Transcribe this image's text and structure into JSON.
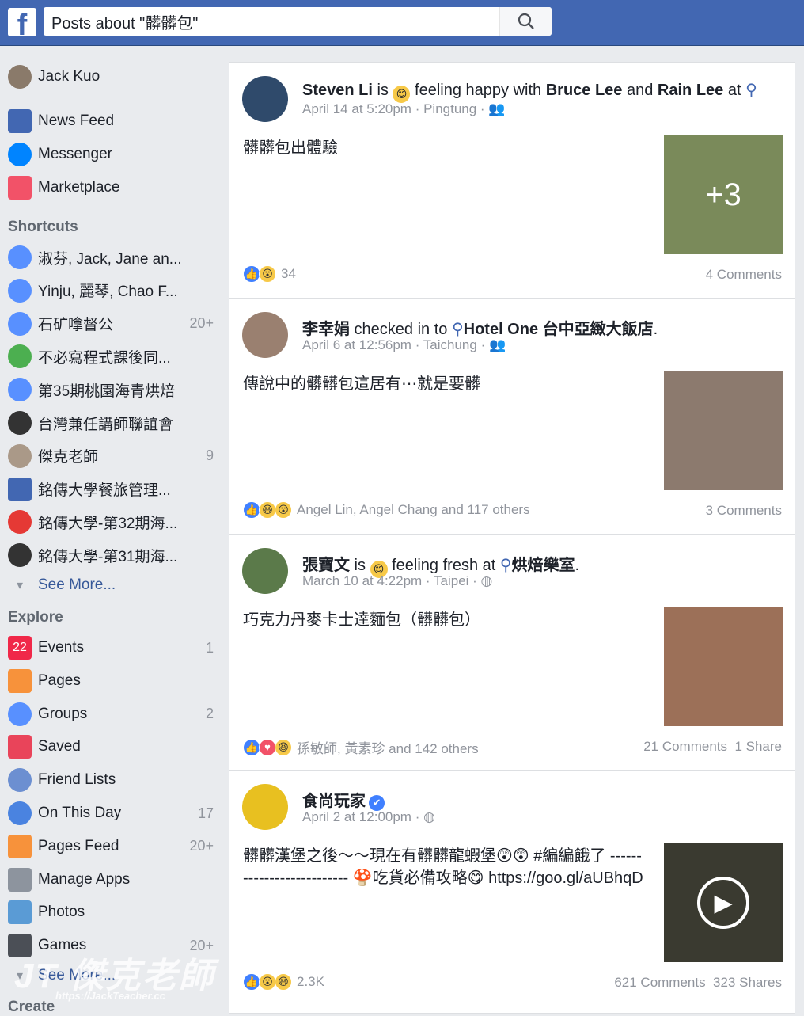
{
  "topbar": {
    "logo": "f",
    "search_value": "Posts about \"髒髒包\""
  },
  "sidebar": {
    "user": {
      "label": "Jack Kuo"
    },
    "main": [
      {
        "label": "News Feed",
        "icon": "news-feed-icon",
        "color": "#4267b2"
      },
      {
        "label": "Messenger",
        "icon": "messenger-icon",
        "color": "#0084ff"
      },
      {
        "label": "Marketplace",
        "icon": "marketplace-icon",
        "color": "#f25268"
      }
    ],
    "shortcuts_title": "Shortcuts",
    "shortcuts": [
      {
        "label": "淑芬, Jack, Jane an...",
        "count": "",
        "icon": "group-icon",
        "color": "#5890ff"
      },
      {
        "label": "Yinju, 麗琴, Chao F...",
        "count": "",
        "icon": "group-icon",
        "color": "#5890ff"
      },
      {
        "label": "石矿嗱督公",
        "count": "20+",
        "icon": "group-icon",
        "color": "#5890ff"
      },
      {
        "label": "不必寫程式課後同...",
        "count": "",
        "icon": "globe-icon",
        "color": "#4caf50"
      },
      {
        "label": "第35期桃園海青烘焙",
        "count": "",
        "icon": "group-icon",
        "color": "#5890ff"
      },
      {
        "label": "台灣兼任講師聯誼會",
        "count": "",
        "icon": "graduation-cap-icon",
        "color": "#333"
      },
      {
        "label": "傑克老師",
        "count": "9",
        "icon": "page-avatar-icon",
        "color": "#a98"
      },
      {
        "label": "銘傳大學餐旅管理...",
        "count": "",
        "icon": "page-icon",
        "color": "#4267b2"
      },
      {
        "label": "銘傳大學-第32期海...",
        "count": "",
        "icon": "apple-icon",
        "color": "#e53935"
      },
      {
        "label": "銘傳大學-第31期海...",
        "count": "",
        "icon": "graduation-cap-icon",
        "color": "#333"
      }
    ],
    "see_more_1": "See More...",
    "explore_title": "Explore",
    "explore": [
      {
        "label": "Events",
        "count": "1",
        "icon": "calendar-icon",
        "color": "#f02849",
        "glyph": "22"
      },
      {
        "label": "Pages",
        "count": "",
        "icon": "flag-icon",
        "color": "#f7923b"
      },
      {
        "label": "Groups",
        "count": "2",
        "icon": "groups-icon",
        "color": "#5890ff"
      },
      {
        "label": "Saved",
        "count": "",
        "icon": "bookmark-icon",
        "color": "#e9445a"
      },
      {
        "label": "Friend Lists",
        "count": "",
        "icon": "friend-list-icon",
        "color": "#6c8fd1"
      },
      {
        "label": "On This Day",
        "count": "17",
        "icon": "clock-icon",
        "color": "#4a83e0"
      },
      {
        "label": "Pages Feed",
        "count": "20+",
        "icon": "pages-feed-icon",
        "color": "#f7923b"
      },
      {
        "label": "Manage Apps",
        "count": "",
        "icon": "wrench-icon",
        "color": "#8d949e"
      },
      {
        "label": "Photos",
        "count": "",
        "icon": "photos-icon",
        "color": "#5a9bd5"
      },
      {
        "label": "Games",
        "count": "20+",
        "icon": "games-icon",
        "color": "#4b4f56"
      }
    ],
    "see_more_2": "See More...",
    "create_title": "Create"
  },
  "posts": [
    {
      "author": "Steven Li",
      "header_rest": [
        " is ",
        "😊",
        " feeling happy with ",
        "Bruce Lee",
        " and ",
        "Rain Lee",
        " at ",
        "📍"
      ],
      "time": "April 14 at 5:20pm",
      "place": "Pingtung",
      "privacy": "friends-icon",
      "body": "髒髒包出體驗",
      "thumb_overlay": "+3",
      "reactions": [
        "like",
        "wow"
      ],
      "reaction_text": "34",
      "stats": "4 Comments",
      "avatar_color": "#2f4a6b",
      "thumb_color": "#7a8a5a"
    },
    {
      "author": "李幸娟",
      "header_rest": [
        " checked in to ",
        "📍",
        "Hotel One 台中亞緻大飯店",
        "."
      ],
      "time": "April 6 at 12:56pm",
      "place": "Taichung",
      "privacy": "friends-icon",
      "body": "傳說中的髒髒包這居有⋯就是要髒",
      "thumb_overlay": "",
      "reactions": [
        "like",
        "haha",
        "wow"
      ],
      "reaction_text": "Angel Lin, Angel Chang and 117 others",
      "stats": "3 Comments",
      "avatar_color": "#9a8070",
      "thumb_color": "#8c7a6e"
    },
    {
      "author": "張寶文",
      "header_rest": [
        " is ",
        "😊",
        " feeling fresh at ",
        "📍",
        "烘焙樂室",
        "."
      ],
      "time": "March 10 at 4:22pm",
      "place": "Taipei",
      "privacy": "globe-icon",
      "body": "巧克力丹麥卡士達麵包（髒髒包）",
      "thumb_overlay": "",
      "reactions": [
        "like",
        "love",
        "haha"
      ],
      "reaction_text": "孫敏師, 黃素珍 and 142 others",
      "stats": "21 Comments  1 Share",
      "avatar_color": "#5b7a4a",
      "thumb_color": "#9c7058"
    },
    {
      "author": "食尚玩家",
      "header_rest": [
        " ✔"
      ],
      "time": "April 2 at 12:00pm",
      "place": "",
      "privacy": "globe-icon",
      "body": "髒髒漢堡之後～～現在有髒髒龍蝦堡😲😲 #編編餓了 -------------------------- 🍄吃貨必備攻略😋 https://goo.gl/aUBhqD",
      "thumb_overlay": "▶",
      "reactions": [
        "like",
        "wow",
        "haha"
      ],
      "reaction_text": "2.3K",
      "stats": "621 Comments  323 Shares",
      "avatar_color": "#e8c020",
      "thumb_color": "#3a3a30"
    }
  ],
  "watermark": {
    "text": "JT 傑克老師",
    "url": "https://JackTeacher.cc"
  }
}
